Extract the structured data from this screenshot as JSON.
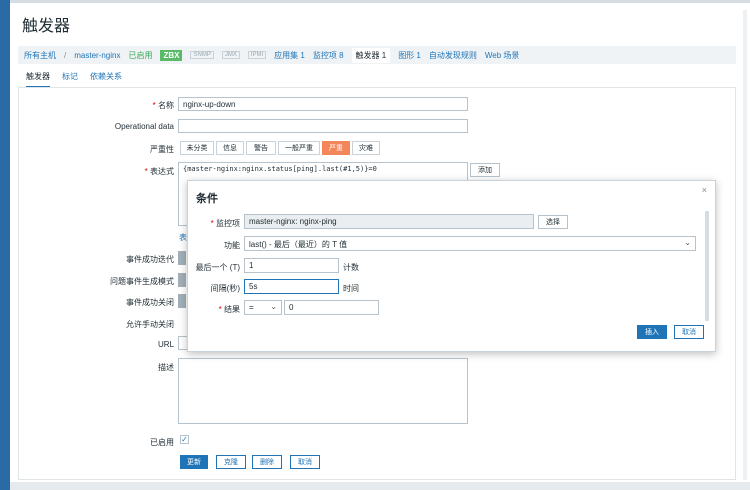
{
  "page_title": "触发器",
  "breadcrumbs": {
    "all_hosts": "所有主机",
    "sep": "/",
    "host": "master-nginx",
    "enabled": "已启用",
    "zbx": "ZBX",
    "snmp": "SNMP",
    "jmx": "JMX",
    "ipmi": "IPMI",
    "apps": "应用集 1",
    "items": "监控项 8",
    "triggers": "触发器 1",
    "graphs": "图形 1",
    "discovery": "自动发现规则",
    "web": "Web 场景"
  },
  "tabs": [
    "触发器",
    "标记",
    "依赖关系"
  ],
  "form": {
    "name_label": "名称",
    "name_value": "nginx-up-down",
    "opdata_label": "Operational data",
    "severity_label": "严重性",
    "severities": [
      "未分类",
      "信息",
      "警告",
      "一般严重",
      "严重",
      "灾难"
    ],
    "selected_severity": "严重",
    "expression_label": "表达式",
    "expression_value": "{master-nginx:nginx.status[ping].last(#1,5)}=0",
    "add_button": "添加",
    "table_fragment": "表",
    "ok_event_label": "事件成功迭代",
    "problem_mode_label": "问题事件生成模式",
    "ok_close_label": "事件成功关闭",
    "manual_close_label": "允许手动关闭",
    "url_label": "URL",
    "description_label": "描述",
    "enabled_label": "已启用",
    "update_button": "更新",
    "clone_button": "克隆",
    "delete_button": "删除",
    "cancel_button": "取消"
  },
  "dialog": {
    "title": "条件",
    "close": "×",
    "item_label": "监控项",
    "item_value": "master-nginx: nginx-ping",
    "select_button": "选择",
    "function_label": "功能",
    "function_value": "last() - 最后（最近）的 T 值",
    "last_label": "最后一个 (T)",
    "last_value": "1",
    "last_unit": "计数",
    "interval_label": "间隔(秒)",
    "interval_value": "5s",
    "interval_unit": "时间",
    "result_label": "结果",
    "result_op": "=",
    "result_value": "0",
    "insert_button": "插入",
    "cancel_button": "取消"
  }
}
